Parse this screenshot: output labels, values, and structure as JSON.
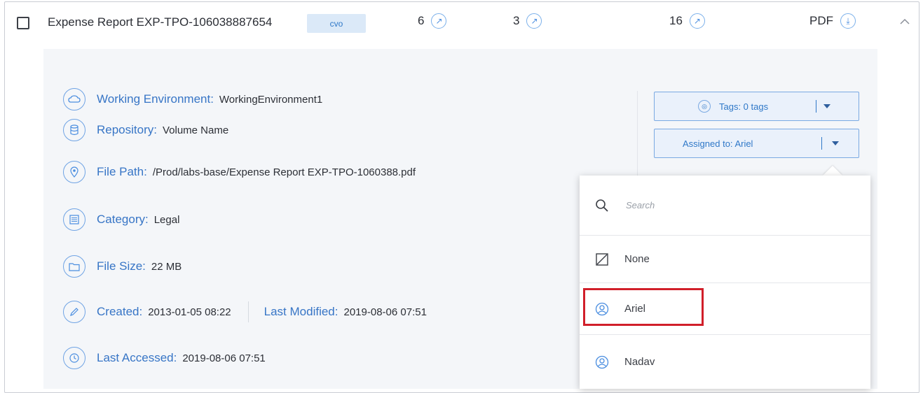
{
  "row": {
    "file_name": "Expense Report EXP-TPO-106038887654",
    "badge": "cvo",
    "stats": [
      {
        "value": "6",
        "icon": "external-link-icon"
      },
      {
        "value": "3",
        "icon": "external-link-icon"
      },
      {
        "value": "16",
        "icon": "external-link-icon"
      }
    ],
    "file_type": "PDF",
    "download_icon": "download-icon",
    "collapse_icon": "chevron-up-icon"
  },
  "details": {
    "working_environment_label": "Working Environment:",
    "working_environment_value": "WorkingEnvironment1",
    "repository_label": "Repository:",
    "repository_value": "Volume Name",
    "file_path_label": "File Path:",
    "file_path_value": "/Prod/labs-base/Expense Report EXP-TPO-1060388.pdf",
    "category_label": "Category:",
    "category_value": "Legal",
    "file_size_label": "File Size:",
    "file_size_value": "22 MB",
    "created_label": "Created:",
    "created_value": "2013-01-05 08:22",
    "last_modified_label": "Last Modified:",
    "last_modified_value": "2019-08-06 07:51",
    "last_accessed_label": "Last Accessed:",
    "last_accessed_value": "2019-08-06 07:51"
  },
  "actions": {
    "tags_label": "Tags: 0 tags",
    "assigned_label": "Assigned to: Ariel"
  },
  "assign_menu": {
    "search_placeholder": "Search",
    "options": [
      {
        "label": "None",
        "icon": "slash-box-icon"
      },
      {
        "label": "Ariel",
        "icon": "user-icon",
        "highlighted": true
      },
      {
        "label": "Nadav",
        "icon": "user-icon"
      }
    ]
  },
  "colors": {
    "accent": "#2f78c8",
    "highlight": "#d11f2a",
    "panel_bg": "#f4f6f9"
  }
}
